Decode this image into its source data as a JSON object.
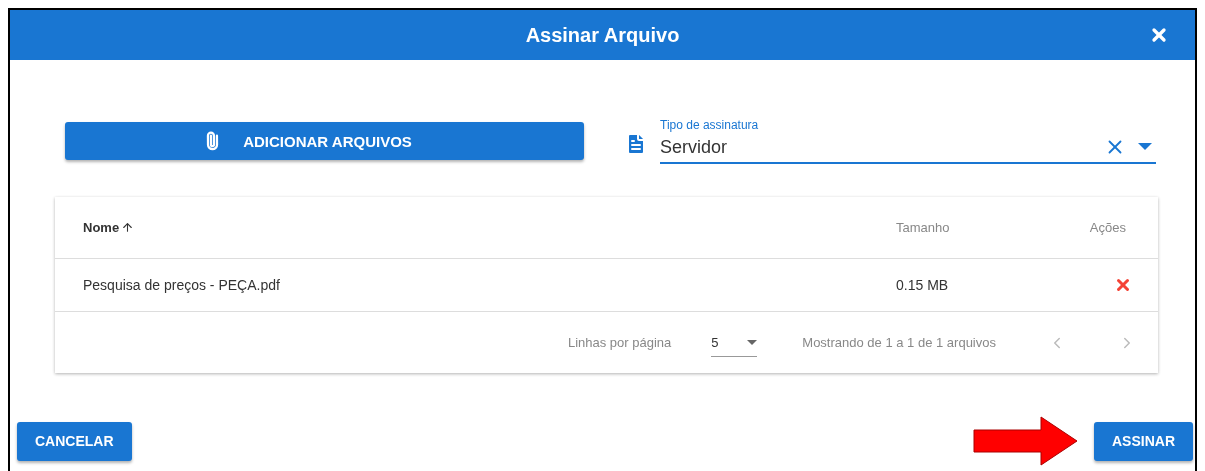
{
  "dialog": {
    "title": "Assinar Arquivo"
  },
  "add_button": {
    "label": "ADICIONAR ARQUIVOS"
  },
  "signature_type": {
    "label": "Tipo de assinatura",
    "value": "Servidor"
  },
  "table": {
    "columns": [
      {
        "label": "Nome",
        "sorted": true
      },
      {
        "label": "Tamanho",
        "sorted": false
      },
      {
        "label": "Ações",
        "sorted": false
      }
    ],
    "rows": [
      {
        "name": "Pesquisa de preços - PEÇA.pdf",
        "size": "0.15 MB"
      }
    ],
    "pagination": {
      "rows_label": "Linhas por página",
      "rows_per_page": "5",
      "range": "Mostrando de 1 a 1 de 1 arquivos",
      "prev_disabled": true,
      "next_disabled": true
    }
  },
  "actions": [
    {
      "label": "CANCELAR"
    },
    {
      "label": "ASSINAR"
    }
  ]
}
